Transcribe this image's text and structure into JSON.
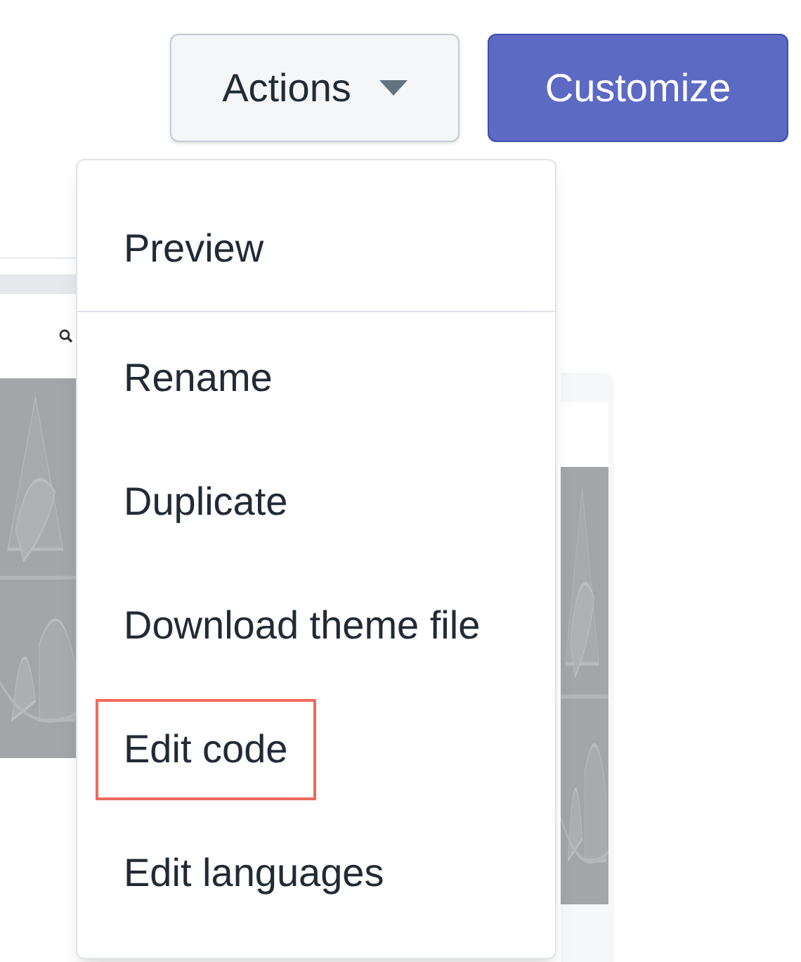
{
  "toolbar": {
    "actions_button": {
      "label": "Actions",
      "expanded": true
    },
    "customize_button": {
      "label": "Customize"
    }
  },
  "menu": {
    "sections": [
      {
        "items": [
          {
            "label": "Preview",
            "highlighted": false
          }
        ]
      },
      {
        "items": [
          {
            "label": "Rename",
            "highlighted": false
          },
          {
            "label": "Duplicate",
            "highlighted": false
          },
          {
            "label": "Download theme file",
            "highlighted": false
          },
          {
            "label": "Edit code",
            "highlighted": true
          },
          {
            "label": "Edit languages",
            "highlighted": false
          }
        ]
      }
    ]
  }
}
